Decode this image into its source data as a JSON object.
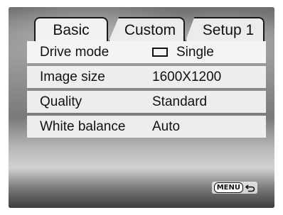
{
  "tabs": [
    {
      "label": "Basic",
      "active": true
    },
    {
      "label": "Custom",
      "active": false
    },
    {
      "label": "Setup 1",
      "active": false
    }
  ],
  "menu": {
    "items": [
      {
        "label": "Drive mode",
        "value": "Single",
        "icon": "single-frame-icon"
      },
      {
        "label": "Image size",
        "value": "1600X1200"
      },
      {
        "label": "Quality",
        "value": "Standard"
      },
      {
        "label": "White balance",
        "value": "Auto"
      }
    ]
  },
  "footer": {
    "menu_key": "MENU",
    "back_icon": "return-arrow-icon"
  }
}
